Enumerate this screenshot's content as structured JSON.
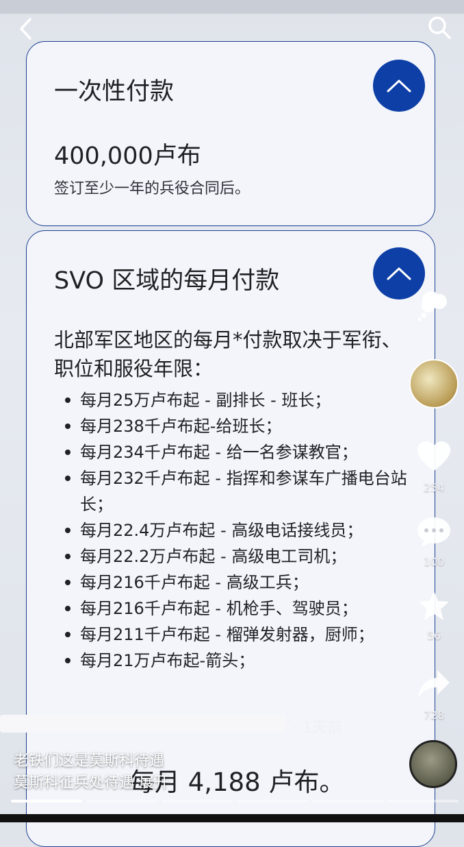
{
  "card1": {
    "title": "一次性付款",
    "amount": "400,000卢布",
    "note": "签订至少一年的兵役合同后。"
  },
  "card2": {
    "title": "SVO 区域的每月付款",
    "intro": "北部军区地区的每月*付款取决于军衔、职位和服役年限：",
    "items": [
      "每月25万卢布起 - 副排长 - 班长；",
      "每月238千卢布起-给班长；",
      "每月234千卢布起 - 给一名参谋教官；",
      "每月232千卢布起 - 指挥和参谋车广播电台站长；",
      "每月22.4万卢布起 - 高级电话接线员；",
      "每月22.2万卢布起 - 高级电工司机；",
      "每月216千卢布起 - 高级工兵；",
      "每月216千卢布起 - 机枪手、驾驶员；",
      "每月211千卢布起 - 榴弹发射器，厨师；",
      "每月21万卢布起-箭头；"
    ],
    "bottom_amount": "每月 4,188 卢布。"
  },
  "comment": {
    "time": "· 1天前"
  },
  "caption": {
    "line1": "老铁们这是莫斯科待遇",
    "line2": "莫斯科征兵处待遇 展开"
  },
  "side": {
    "like_count": "254",
    "comment_count": "100",
    "favorite_count": "56",
    "share_count": "728"
  },
  "progress": {
    "segments": 6,
    "active_index": 0
  },
  "colors": {
    "accent": "#0d3fa6",
    "card_border": "#1c3f91",
    "card_bg": "#f3f5fa"
  }
}
